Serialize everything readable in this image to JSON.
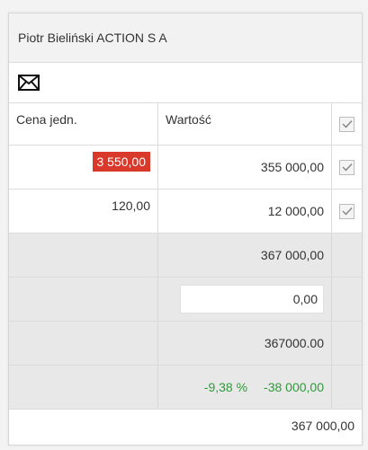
{
  "header": {
    "title": "Piotr Bieliński ACTION S A"
  },
  "icons": {
    "mail": "envelope-icon",
    "check": "checkmark-icon"
  },
  "table": {
    "columns": {
      "unit_price": "Cena jedn.",
      "value": "Wartość"
    },
    "rows": [
      {
        "unit_price": "3 550,00",
        "value": "355 000,00",
        "highlight_color": "#d9392b",
        "checked": true
      },
      {
        "unit_price": "120,00",
        "value": "12 000,00",
        "checked": true
      }
    ],
    "summary": {
      "subtotal": "367 000,00",
      "input_value": "0,00",
      "plain_total": "367000.00",
      "diff_percent": "-9,38 %",
      "diff_value": "-38 000,00",
      "diff_color": "#2e9a3a"
    }
  },
  "footer": {
    "total": "367 000,00"
  }
}
